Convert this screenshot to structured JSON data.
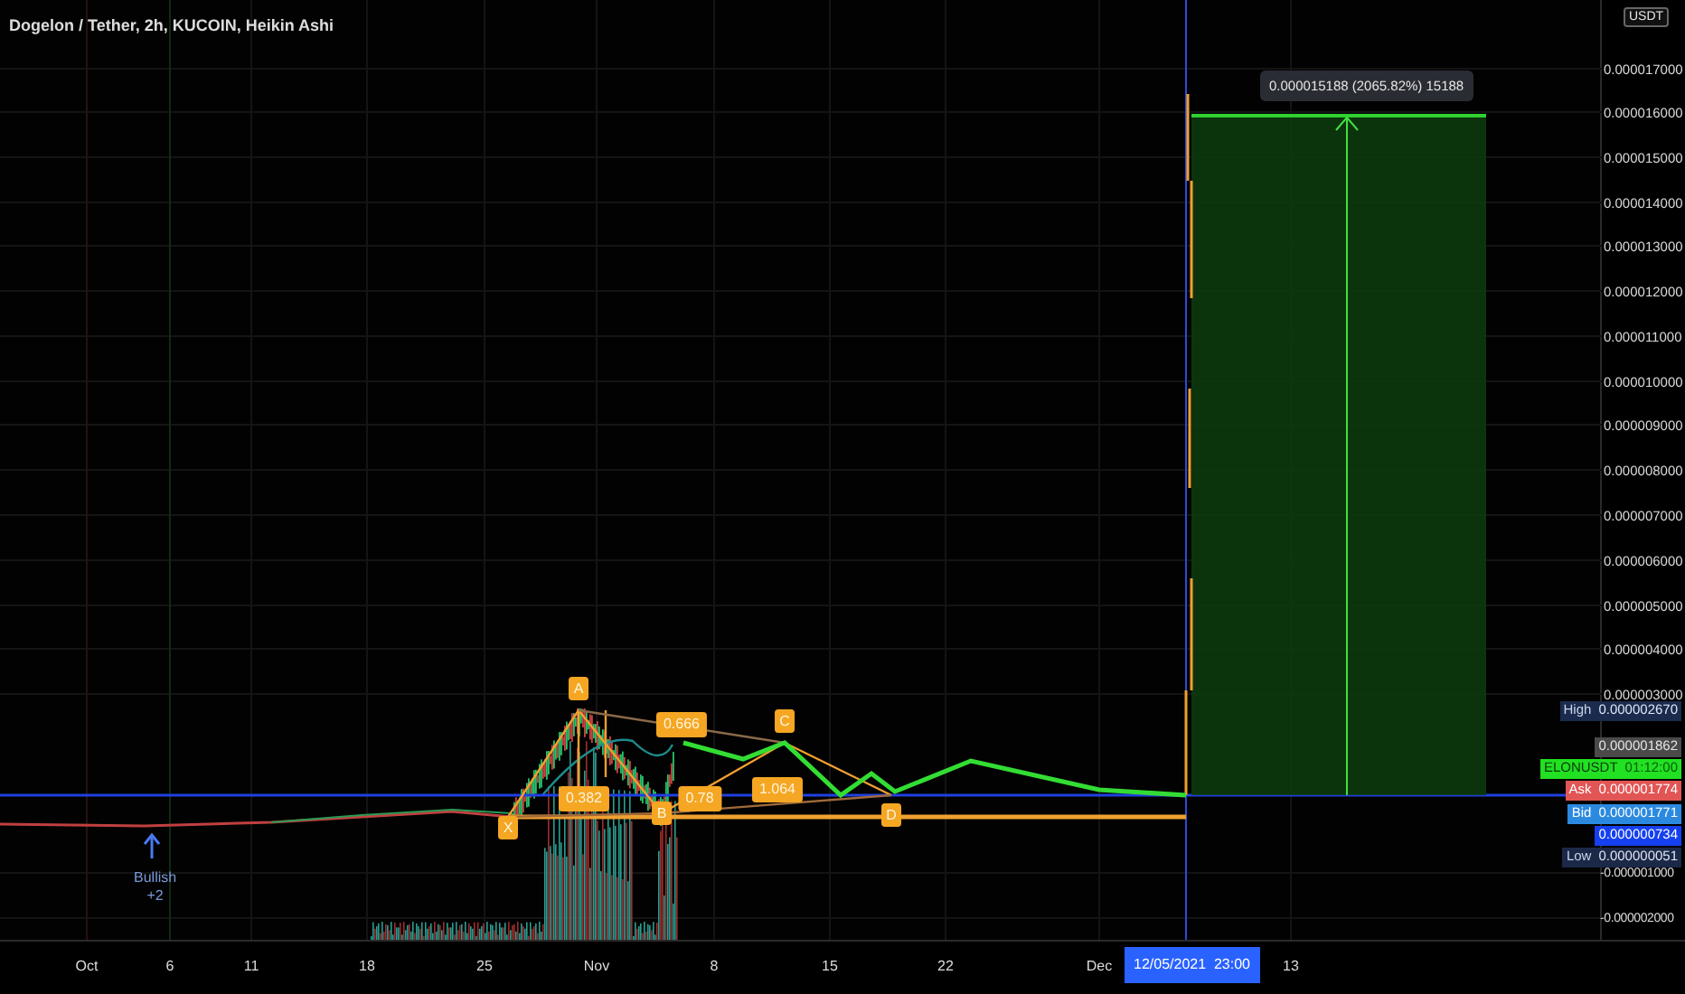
{
  "chart": {
    "title": "Dogelon / Tether, 2h, KUCOIN, Heikin Ashi",
    "pattern_labels": [
      {
        "kind": "point",
        "text": "A"
      },
      {
        "kind": "point",
        "text": "X"
      },
      {
        "kind": "point",
        "text": "B"
      },
      {
        "kind": "point",
        "text": "C"
      },
      {
        "kind": "point",
        "text": "D"
      },
      {
        "kind": "ratio",
        "text": "0.666"
      },
      {
        "kind": "ratio",
        "text": "0.382"
      },
      {
        "kind": "ratio",
        "text": "0.78"
      },
      {
        "kind": "ratio",
        "text": "1.064"
      }
    ],
    "signal": {
      "label": "Bullish",
      "count": "+2"
    },
    "measure_label": "0.000015188 (2065.82%) 15188"
  },
  "price_axis": {
    "currency": "USDT",
    "ticks": [
      "0.000017000",
      "0.000016000",
      "0.000015000",
      "0.000014000",
      "0.000013000",
      "0.000012000",
      "0.000011000",
      "0.000010000",
      "0.000009000",
      "0.000008000",
      "0.000007000",
      "0.000006000",
      "0.000005000",
      "0.000004000",
      "0.000003000",
      "-0.000001000",
      "-0.000002000"
    ],
    "badges": [
      {
        "kind": "high",
        "label": "High",
        "value": "0.000002670"
      },
      {
        "kind": "last",
        "value": "0.000001862"
      },
      {
        "kind": "countdown",
        "label": "ELONUSDT",
        "value": "01:12:00"
      },
      {
        "kind": "ask",
        "label": "Ask",
        "value": "0.000001774"
      },
      {
        "kind": "bid",
        "label": "Bid",
        "value": "0.000001771"
      },
      {
        "kind": "current",
        "value": "0.000000734"
      },
      {
        "kind": "low",
        "label": "Low",
        "value": "0.000000051"
      }
    ]
  },
  "time_axis": {
    "labels": [
      "Oct",
      "6",
      "11",
      "18",
      "25",
      "Nov",
      "8",
      "15",
      "22",
      "Dec",
      "13"
    ],
    "cursor": "12/05/2021  23:00"
  }
}
